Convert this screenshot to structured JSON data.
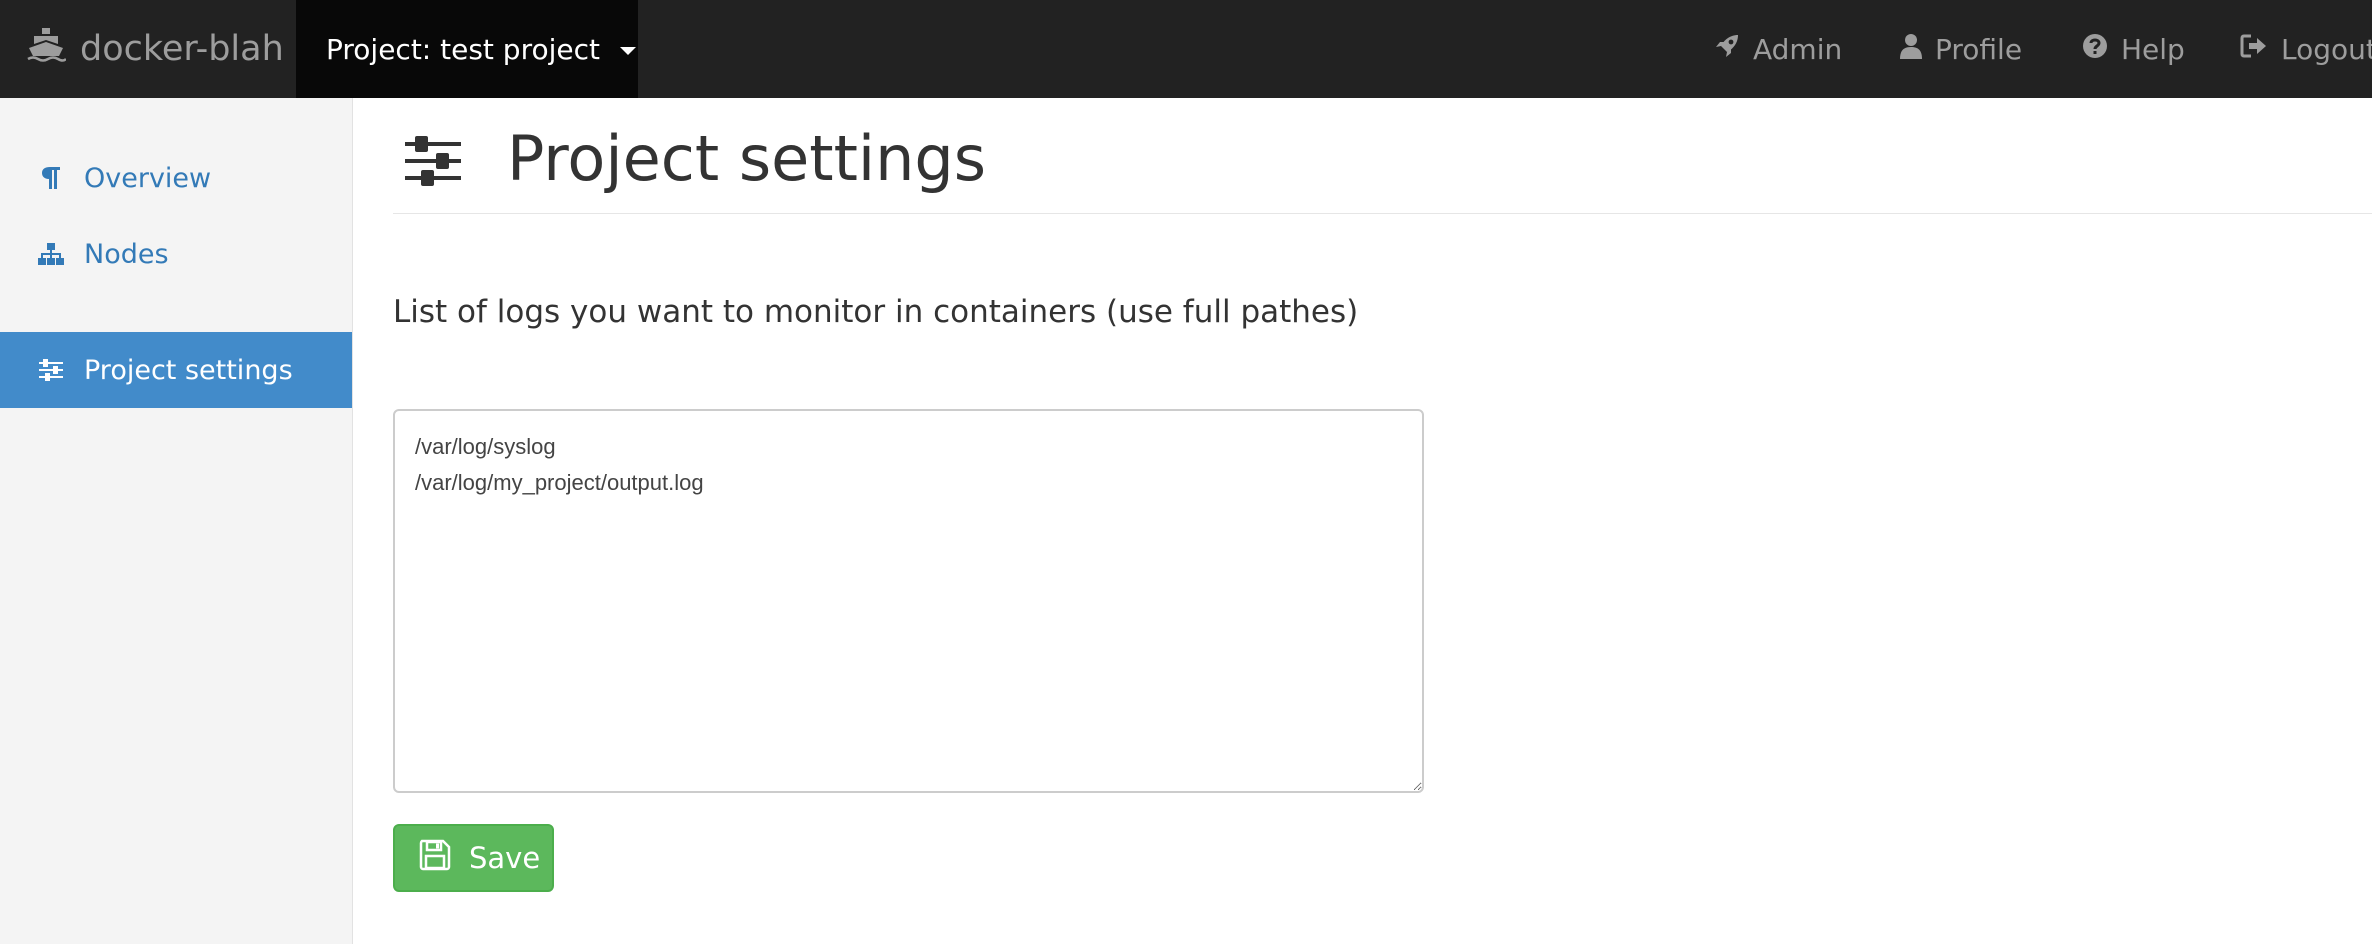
{
  "navbar": {
    "brand": "docker-blah",
    "project_menu": "Project: test project",
    "links": {
      "admin": "Admin",
      "profile": "Profile",
      "help": "Help",
      "logout": "Logout"
    }
  },
  "sidebar": {
    "items": [
      {
        "label": "Overview",
        "icon": "paragraph-icon"
      },
      {
        "label": "Nodes",
        "icon": "sitemap-icon"
      },
      {
        "label": "Project settings",
        "icon": "sliders-icon",
        "active": true
      }
    ]
  },
  "main": {
    "title": "Project settings",
    "logs_label": "List of logs you want to monitor in containers (use full pathes)",
    "logs_value": "/var/log/syslog\n/var/log/my_project/output.log",
    "save_label": "Save"
  },
  "colors": {
    "navbar_bg": "#222222",
    "active_menu_bg": "#080808",
    "sidebar_active": "#428bca",
    "link": "#337ab7",
    "save_button": "#5cb85c"
  }
}
